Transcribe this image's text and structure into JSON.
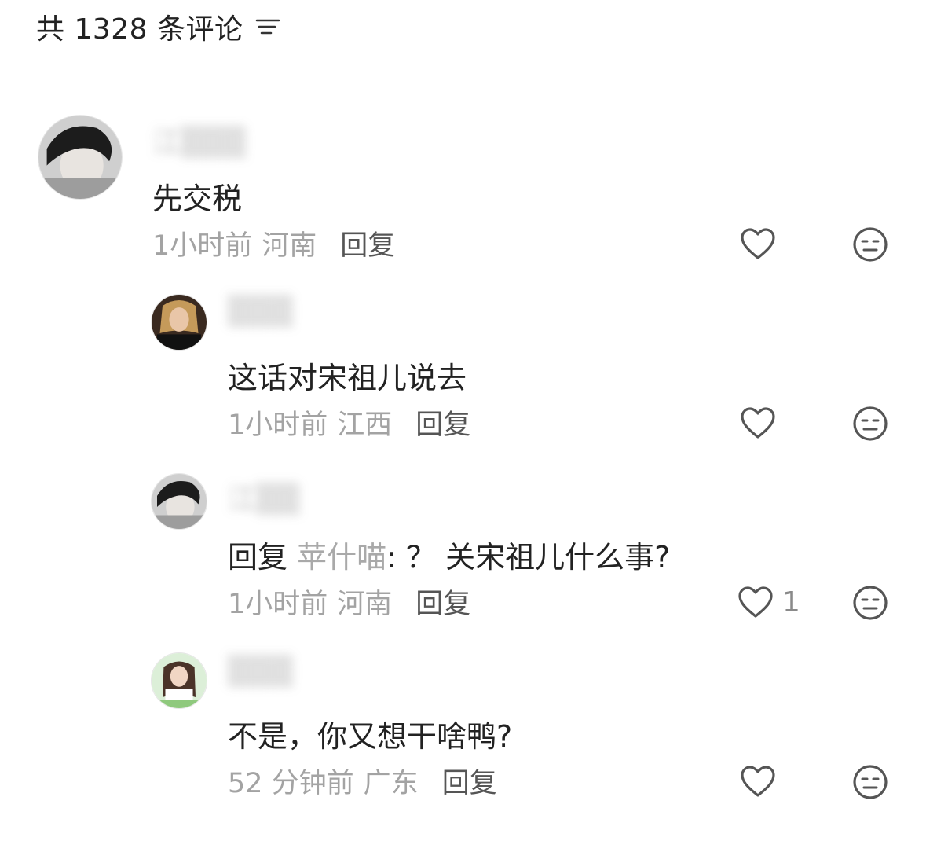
{
  "header": {
    "title": "共 1328 条评论",
    "filter_icon": "filter-lines-icon"
  },
  "comments": [
    {
      "username": "江▒▒▒",
      "text": "先交税",
      "time": "1小时前",
      "location": "河南",
      "reply_label": "回复",
      "likes": ""
    },
    {
      "username": "▒▒▒",
      "text": "这话对宋祖儿说去",
      "time": "1小时前",
      "location": "江西",
      "reply_label": "回复",
      "likes": ""
    },
    {
      "username": "江▒▒",
      "reply_prefix": "回复",
      "reply_target": "苹什喵",
      "text": ": ？ 关宋祖儿什么事?",
      "time": "1小时前",
      "location": "河南",
      "reply_label": "回复",
      "likes": "1"
    },
    {
      "username": "▒▒▒",
      "text": "不是，你又想干啥鸭?",
      "time": "52 分钟前",
      "location": "广东",
      "reply_label": "回复",
      "likes": ""
    }
  ],
  "icons": {
    "like": "heart-outline-icon",
    "dislike": "neutral-face-icon"
  },
  "colors": {
    "primary_text": "#222222",
    "meta_text": "#a3a3a3",
    "icon_stroke": "#555555"
  }
}
